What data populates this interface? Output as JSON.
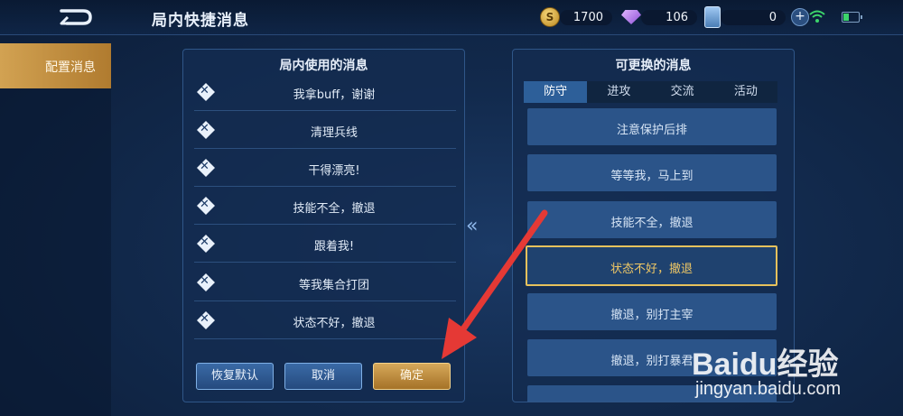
{
  "header": {
    "title": "局内快捷消息",
    "gold": "1700",
    "gems": "106",
    "cards": "0",
    "plus": "+",
    "coin_glyph": "S"
  },
  "sidebar": {
    "tab_label": "配置消息"
  },
  "used_panel": {
    "title": "局内使用的消息",
    "remove_glyph": "✕",
    "messages": [
      "我拿buff，谢谢",
      "清理兵线",
      "干得漂亮!",
      "技能不全，撤退",
      "跟着我!",
      "等我集合打团",
      "状态不好，撤退"
    ],
    "buttons": {
      "reset": "恢复默认",
      "cancel": "取消",
      "confirm": "确定"
    }
  },
  "replace_panel": {
    "title": "可更换的消息",
    "tabs": [
      "防守",
      "进攻",
      "交流",
      "活动"
    ],
    "active_tab": "防守",
    "options": [
      "注意保护后排",
      "等等我，马上到",
      "技能不全，撤退",
      "状态不好，撤退",
      "撤退，别打主宰",
      "撤退，别打暴君"
    ],
    "selected_option": "状态不好，撤退"
  },
  "swap_arrow": "«",
  "watermark": {
    "line1": "Baidu经验",
    "line2": "jingyan.baidu.com"
  },
  "colors": {
    "accent_gold": "#d2a252",
    "selected_border": "#e6c15c",
    "annotation_arrow": "#e53935"
  }
}
